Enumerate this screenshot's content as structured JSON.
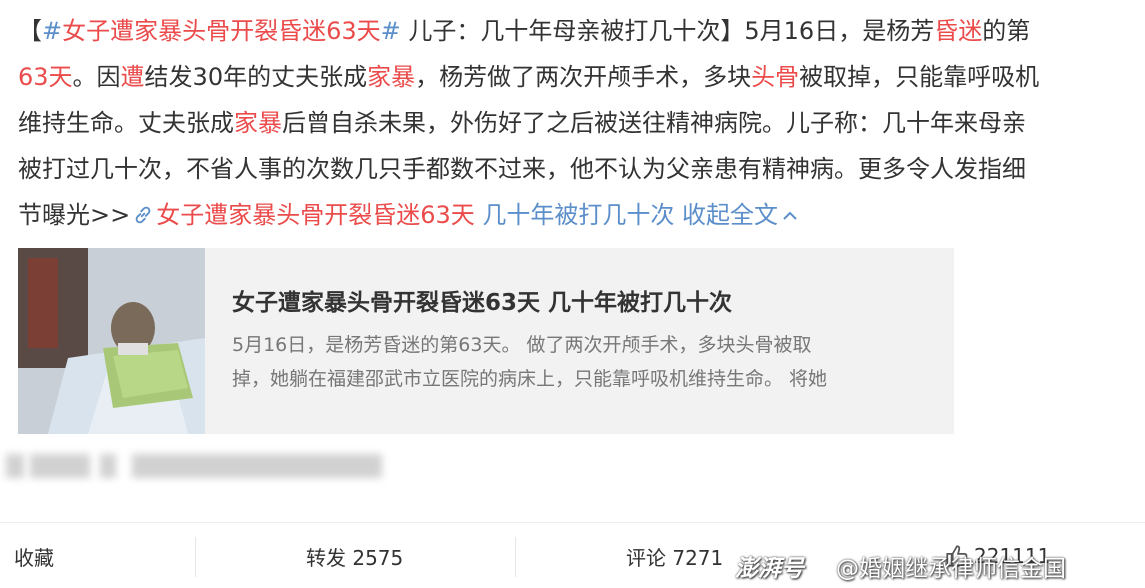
{
  "post": {
    "topic_open": "【",
    "topic_hash1": "#",
    "topic_text": "女子遭家暴头骨开裂昏迷63天",
    "topic_hash2": "#",
    "l1_mid": " 儿子：几十年母亲被打几十次】5月16日，是杨芳",
    "l1_kw": "昏迷",
    "l1_end": "的第",
    "l2_kw1": "63天",
    "l2_a": "。因",
    "l2_kw2": "遭",
    "l2_b": "结发30年的丈夫张成",
    "l2_kw3": "家暴",
    "l2_c": "，杨芳做了两次开颅手术，多块",
    "l2_kw4": "头骨",
    "l2_d": "被取掉，只能靠呼吸机",
    "l3_a": "维持生命。丈夫张成",
    "l3_kw": "家暴",
    "l3_b": "后曾自杀未果，外伤好了之后被送往精神病院。儿子称：几十年来母亲",
    "l4": "被打过几十次，不省人事的次数几只手都数不过来，他不认为父亲患有精神病。更多令人发指细",
    "l5_a": "节曝光>>",
    "l5_link": "女子遭家暴头骨开裂昏迷63天",
    "l5_link2": " 几十年被打几十次",
    "collapse_label": " 收起全文"
  },
  "card": {
    "title": "女子遭家暴头骨开裂昏迷63天 几十年被打几十次",
    "desc_line1": "5月16日，是杨芳昏迷的第63天。 做了两次开颅手术，多块头骨被取",
    "desc_line2": "掉，她躺在福建邵武市立医院的病床上，只能靠呼吸机维持生命。 将她"
  },
  "actions": {
    "favorite": "收藏",
    "repost": "转发 2575",
    "comment": "评论 7271",
    "like": "221111"
  },
  "watermark": {
    "left": "澎湃号",
    "right": "@婚姻继承律师信金国"
  },
  "icons": {
    "link": "link-icon",
    "chevron": "chevron-up-icon",
    "thumb": "thumb-up-icon"
  },
  "colors": {
    "keyword": "#eb4b4b",
    "link": "#5c8fca",
    "text": "#333333",
    "card_bg": "#f2f2f2"
  }
}
